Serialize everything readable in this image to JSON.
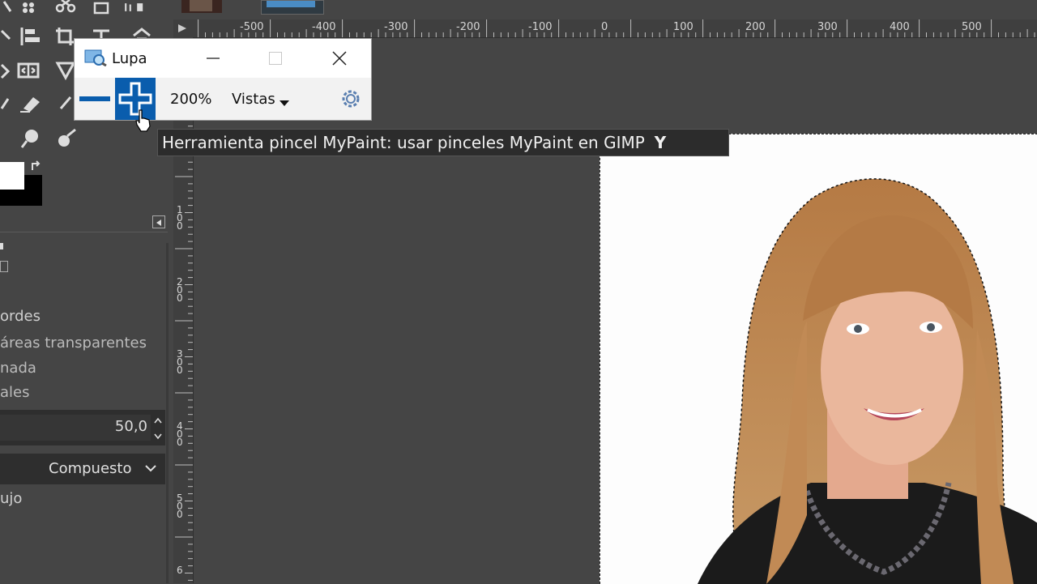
{
  "magnifier": {
    "title": "Lupa",
    "zoom_level": "200%",
    "views_label": "Vistas"
  },
  "tooltip": {
    "text": "Herramienta pincel MyPaint: usar pinceles MyPaint en GIMP",
    "shortcut": "Y"
  },
  "tool_options": {
    "item_bordes": "ordes",
    "item_transparent": "áreas transparentes",
    "item_nada": "nada",
    "item_ales": "ales",
    "value": "50,0",
    "mode": "Compuesto",
    "item_ujo": "ujo"
  },
  "ruler": {
    "h_labels": [
      "-500",
      "-400",
      "-300",
      "-200",
      "-100",
      "0",
      "100",
      "200",
      "300",
      "400",
      "500"
    ],
    "v_labels": [
      "1",
      "0",
      "0",
      "2",
      "0",
      "0",
      "3",
      "0",
      "0",
      "4",
      "0",
      "0",
      "5",
      "0",
      "0",
      "6"
    ]
  },
  "colors": {
    "panel_bg": "#454545",
    "ruler_bg": "#3f3f3f",
    "accent_blue": "#0a5dad",
    "tooltip_bg": "#2c2c2c"
  }
}
